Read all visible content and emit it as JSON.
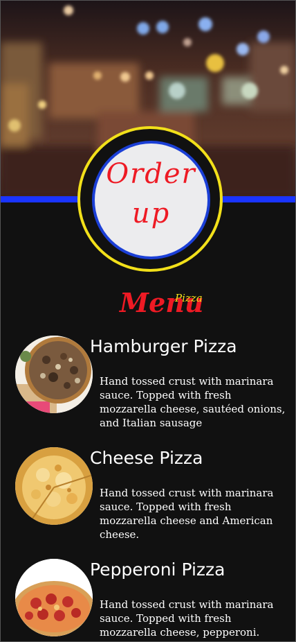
{
  "logo": {
    "line1": "Order",
    "line2": "up"
  },
  "menu": {
    "title": "Menu",
    "subtitle": "Pizza",
    "items": [
      {
        "name": "Hamburger Pizza",
        "description": "Hand tossed crust with marinara sauce. Topped with fresh mozzarella cheese, sautéed onions, and Italian sausage"
      },
      {
        "name": "Cheese Pizza",
        "description": "Hand tossed crust with marinara sauce. Topped with fresh mozzarella cheese and American cheese."
      },
      {
        "name": "Pepperoni Pizza",
        "description": "Hand tossed crust with marinara sauce. Topped with fresh mozzarella cheese, pepperoni."
      }
    ]
  },
  "colors": {
    "background": "#111111",
    "accent_blue": "#1a34ff",
    "accent_yellow": "#f2e01a",
    "accent_red": "#ee1a24"
  }
}
